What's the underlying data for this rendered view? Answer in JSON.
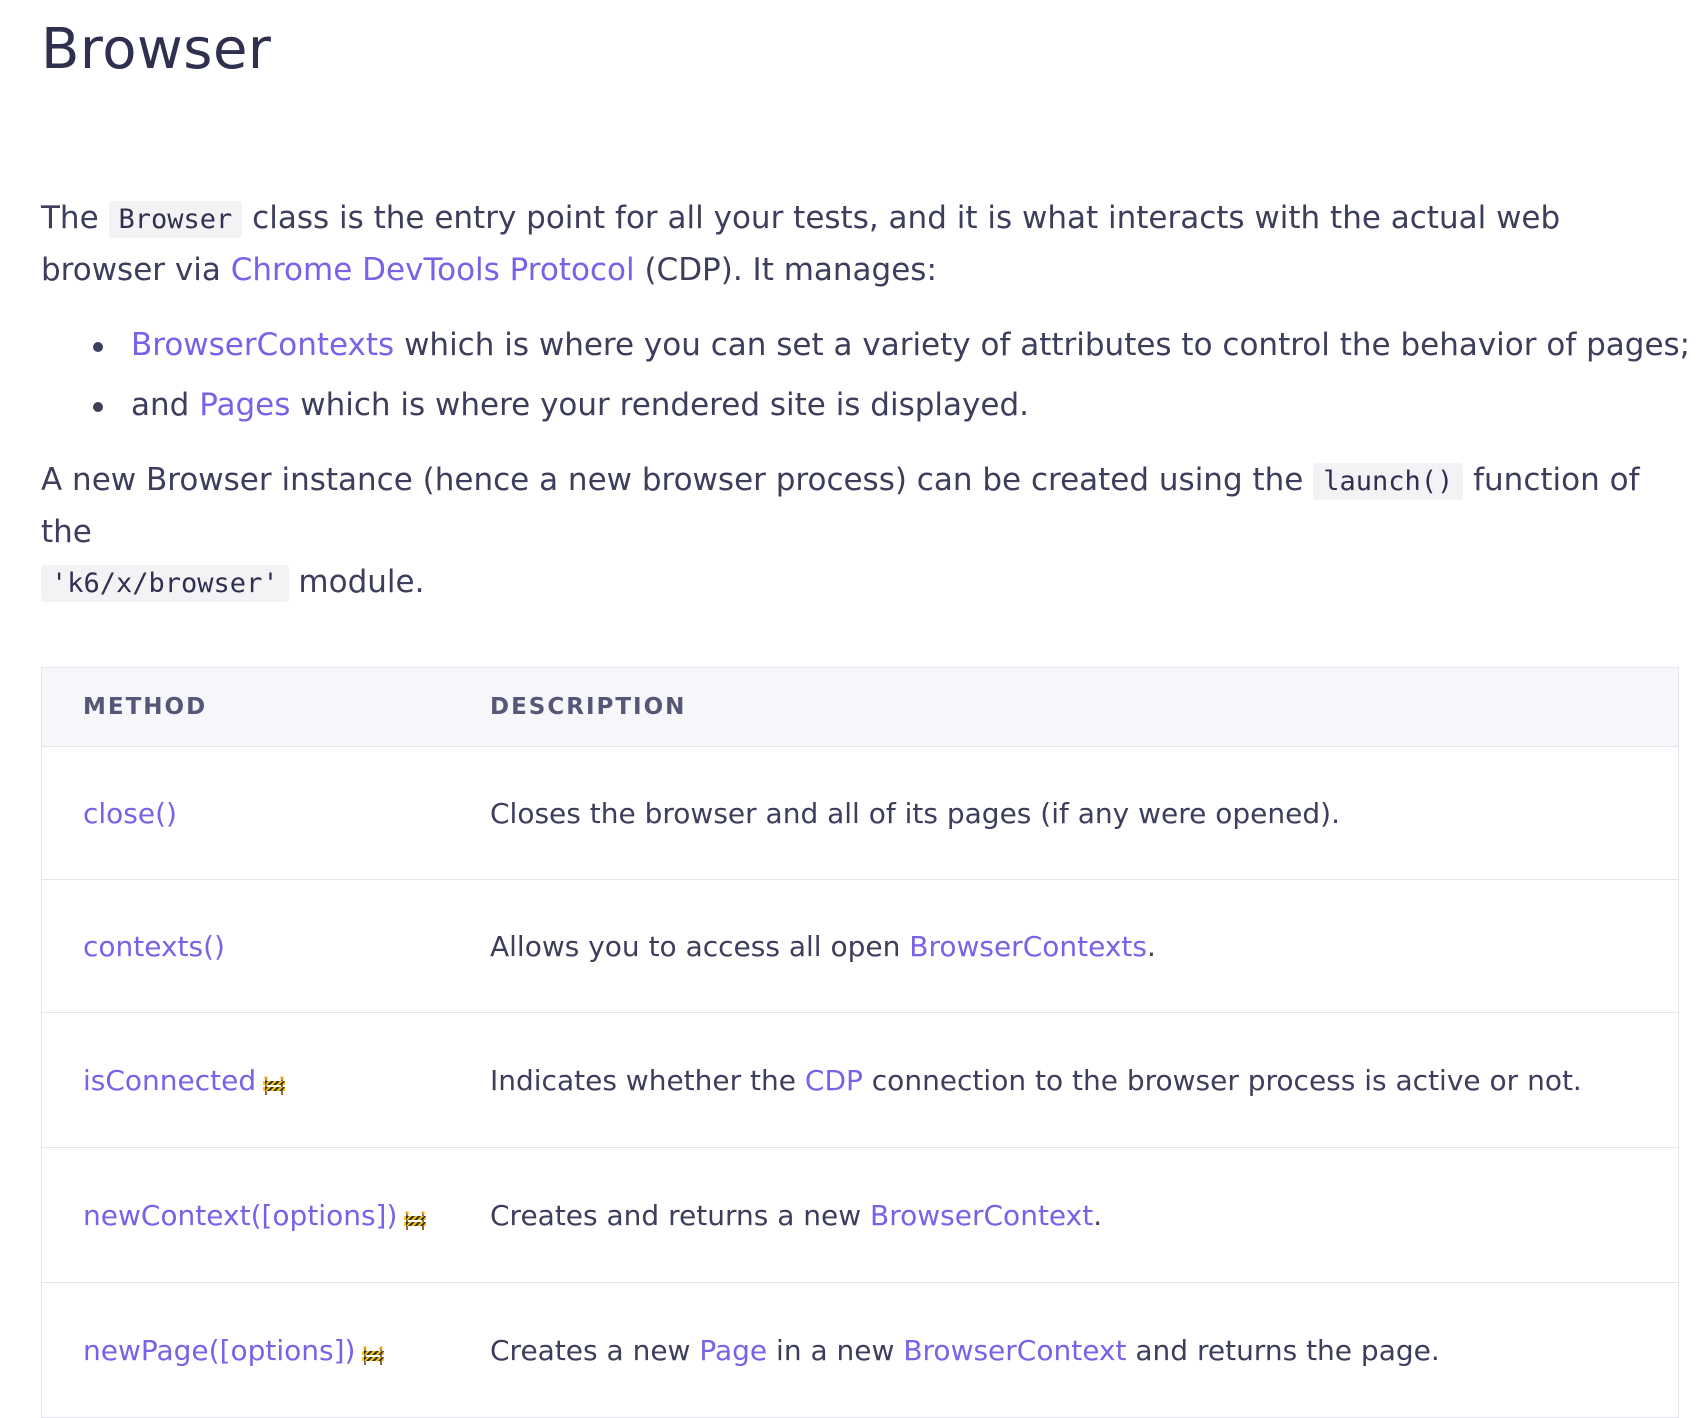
{
  "page": {
    "title": "Browser"
  },
  "intro": {
    "t1": "The ",
    "code_browser": "Browser",
    "t2": " class is the entry point for all your tests, and it is what interacts with the actual web browser via ",
    "link_cdp": "Chrome DevTools Protocol",
    "t3": " (CDP). It manages:"
  },
  "bullets": {
    "b1_link": "BrowserContexts",
    "b1_text": " which is where you can set a variety of attributes to control the behavior of pages;",
    "b2_pre": "and ",
    "b2_link": "Pages",
    "b2_text": " which is where your rendered site is displayed."
  },
  "para2": {
    "t1": "A new Browser instance (hence a new browser process) can be created using the ",
    "code_launch": "launch()",
    "t2": " function of the ",
    "code_module": "'k6/x/browser'",
    "t3": " module."
  },
  "table": {
    "header_method": "METHOD",
    "header_description": "DESCRIPTION",
    "rows": [
      {
        "method": "close()",
        "desc_pre": "Closes the browser and all of its pages (if any were opened)."
      },
      {
        "method": "contexts()",
        "desc_pre": "Allows you to access all open ",
        "desc_link": "BrowserContexts",
        "desc_post": "."
      },
      {
        "method": "isConnected",
        "desc_pre": "Indicates whether the ",
        "desc_link": "CDP",
        "desc_post": " connection to the browser process is active or not."
      },
      {
        "method": "newContext([options])",
        "desc_pre": "Creates and returns a new ",
        "desc_link": "BrowserContext",
        "desc_post": "."
      },
      {
        "method": "newPage([options])",
        "desc_pre": "Creates a new ",
        "desc_link": "Page",
        "desc_mid": " in a new ",
        "desc_link2": "BrowserContext",
        "desc_post": " and returns the page."
      }
    ]
  },
  "icons": {
    "wip": "construction-icon"
  },
  "colors": {
    "link": "#7b61e8",
    "text": "#3d3d5c",
    "heading": "#2f2f4f",
    "header_bg": "#f7f7fb",
    "border": "#e4e4ec",
    "code_bg": "#f3f3f6"
  }
}
